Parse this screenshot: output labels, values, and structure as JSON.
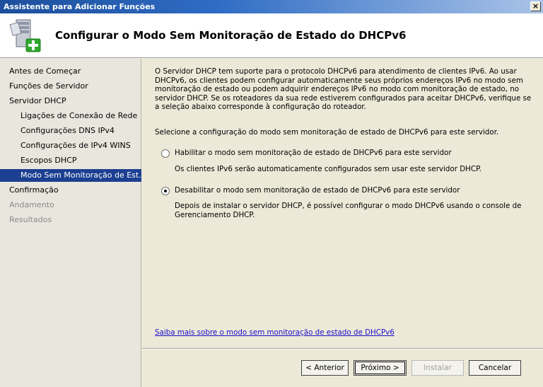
{
  "window": {
    "title": "Assistente para Adicionar Funções",
    "close_glyph": "×"
  },
  "header": {
    "title": "Configurar o Modo Sem Monitoração de Estado do DHCPv6",
    "icon": "server-add-icon"
  },
  "sidebar": {
    "items": [
      {
        "label": "Antes de Começar"
      },
      {
        "label": "Funções de Servidor"
      },
      {
        "label": "Servidor DHCP"
      },
      {
        "label": "Ligações de Conexão de Rede"
      },
      {
        "label": "Configurações DNS IPv4"
      },
      {
        "label": "Configurações de IPv4 WINS"
      },
      {
        "label": "Escopos DHCP"
      },
      {
        "label": "Modo Sem Monitoração de Est..."
      },
      {
        "label": "Confirmação"
      },
      {
        "label": "Andamento"
      },
      {
        "label": "Resultados"
      }
    ]
  },
  "main": {
    "intro": "O Servidor DHCP tem suporte para o protocolo DHCPv6 para atendimento de clientes IPv6. Ao usar DHCPv6, os clientes podem configurar automaticamente seus próprios endereços IPv6 no modo sem monitoração de estado ou podem adquirir endereços IPv6 no modo com monitoração de estado, no servidor DHCP. Se os roteadores da sua rede estiverem configurados para aceitar DHCPv6, verifique se a seleção abaixo corresponde à configuração do roteador.",
    "prompt": "Selecione a configuração do modo sem monitoração de estado de DHCPv6 para este servidor.",
    "option_enable": {
      "label": "Habilitar o modo sem monitoração de estado de DHCPv6 para este servidor",
      "description": "Os clientes IPv6 serão automaticamente configurados sem usar este servidor DHCP.",
      "selected": false
    },
    "option_disable": {
      "label": "Desabilitar o modo sem monitoração de estado de DHCPv6 para este servidor",
      "description": "Depois de instalar o servidor DHCP, é possível configurar o modo DHCPv6 usando o console de Gerenciamento DHCP.",
      "selected": true
    },
    "learn_more_link": "Saiba mais sobre o modo sem monitoração de estado de DHCPv6"
  },
  "footer": {
    "previous": "< Anterior",
    "next": "Próximo >",
    "install": "Instalar",
    "cancel": "Cancelar"
  },
  "colors": {
    "active_nav": "#1c3f91",
    "link": "#1a0dcc"
  }
}
